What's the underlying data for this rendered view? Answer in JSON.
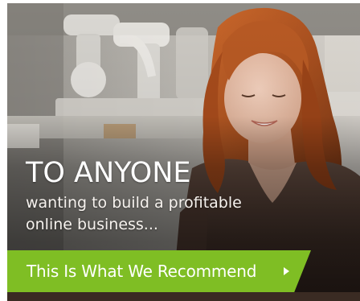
{
  "ad": {
    "headline": "TO ANYONE",
    "subline": [
      "wanting to build a profitable",
      "online business..."
    ],
    "cta_label": "This Is What We Recommend",
    "cta_icon": "play-arrow-icon"
  },
  "colors": {
    "cta_background": "#7fbe24",
    "text": "#ffffff",
    "hair": "#b65a26"
  }
}
